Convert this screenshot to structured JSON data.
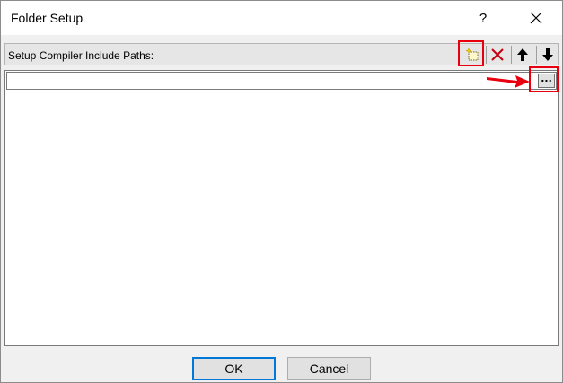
{
  "window": {
    "title": "Folder Setup",
    "help_label": "?",
    "close_icon": "close-icon"
  },
  "header": {
    "label": "Setup Compiler Include Paths:",
    "toolbar": {
      "new_icon": "new-folder-icon",
      "delete_icon": "delete-icon",
      "move_up_icon": "arrow-up-icon",
      "move_down_icon": "arrow-down-icon"
    }
  },
  "path_list": {
    "items": [
      {
        "value": "",
        "browse_label": "..."
      }
    ]
  },
  "footer": {
    "ok_label": "OK",
    "cancel_label": "Cancel"
  },
  "colors": {
    "highlight": "#e8000e",
    "dialog_bg": "#f0f0f0",
    "accent": "#0078d7"
  }
}
